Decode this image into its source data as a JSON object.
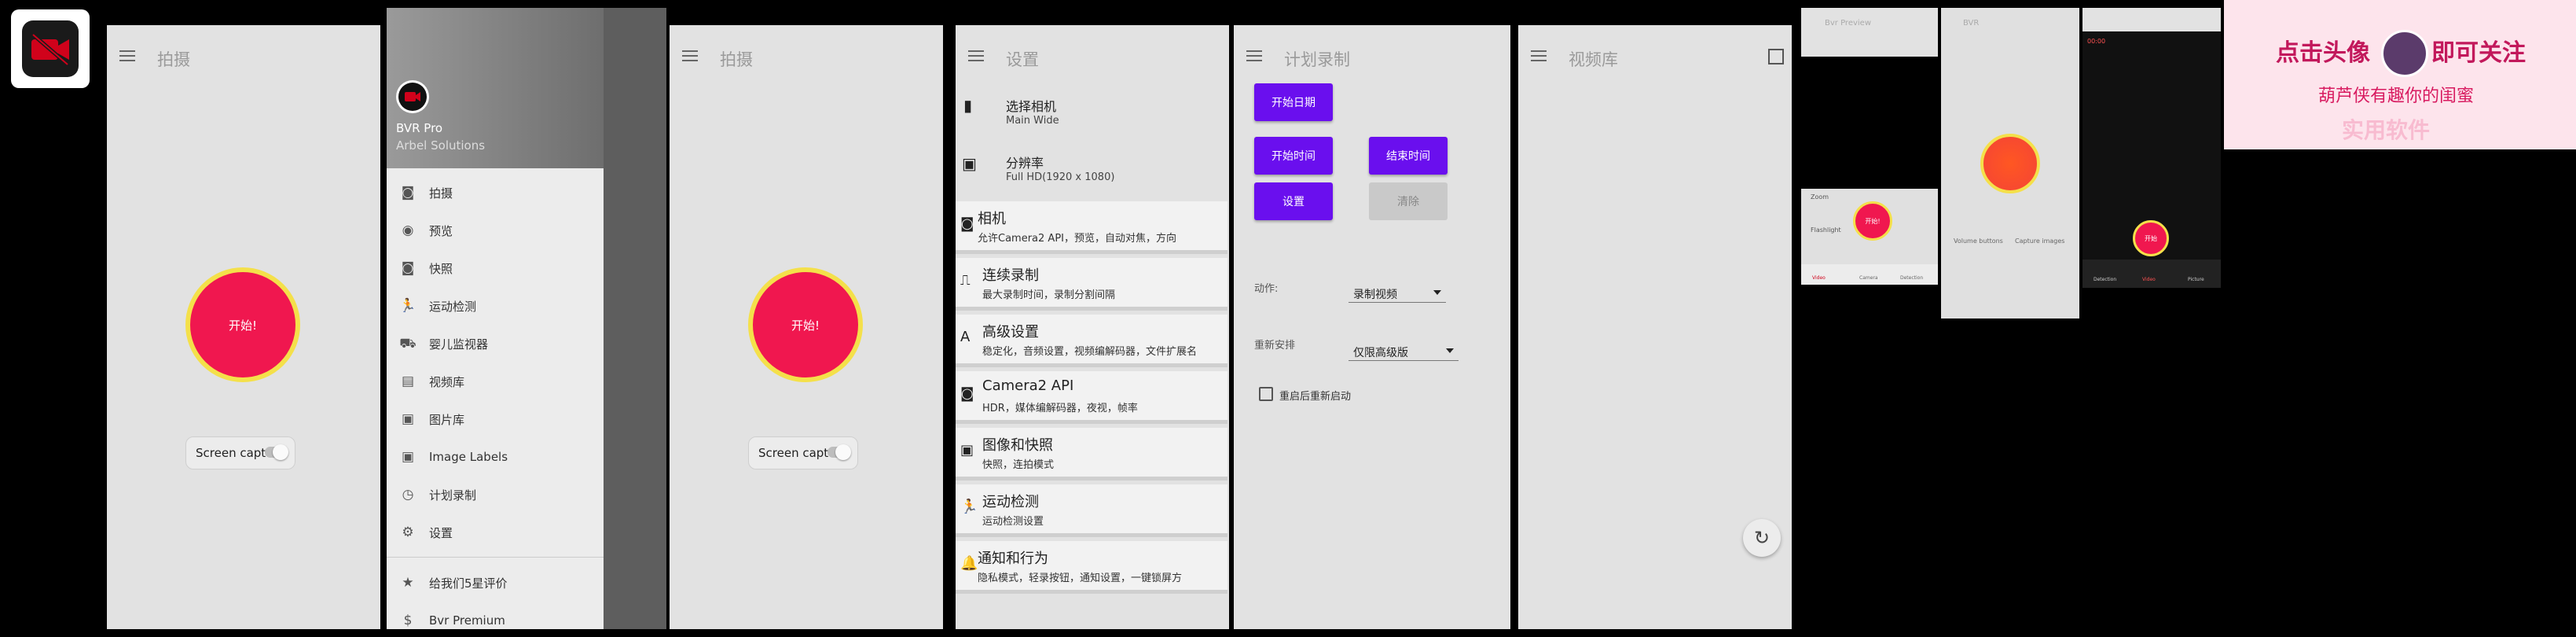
{
  "app_icon": {
    "icon": "camera-off-icon",
    "accent": "#d0021b"
  },
  "home": {
    "title": "拍摄",
    "record_label": "开始!",
    "capture_label": "Screen capture"
  },
  "drawer": {
    "app_name": "BVR Pro",
    "company": "Arbel Solutions",
    "items": [
      {
        "icon": "camera-icon",
        "label": "拍摄"
      },
      {
        "icon": "eye-icon",
        "label": "预览"
      },
      {
        "icon": "camera-icon",
        "label": "快照"
      },
      {
        "icon": "running-icon",
        "label": "运动检测"
      },
      {
        "icon": "stroller-icon",
        "label": "婴儿监视器"
      },
      {
        "icon": "video-library-icon",
        "label": "视频库"
      },
      {
        "icon": "image-icon",
        "label": "图片库"
      },
      {
        "icon": "image-icon",
        "label": "Image Labels"
      },
      {
        "icon": "timer-icon",
        "label": "计划录制"
      },
      {
        "icon": "gear-icon",
        "label": "设置"
      }
    ],
    "footer": [
      {
        "icon": "star-icon",
        "label": "给我们5星评价"
      },
      {
        "icon": "dollar-icon",
        "label": "Bvr Premium"
      }
    ]
  },
  "home2": {
    "title": "拍摄",
    "record_label": "开始!",
    "capture_label": "Screen capture"
  },
  "settings": {
    "title": "设置",
    "rows": [
      {
        "icon": "phone-icon",
        "title": "选择相机",
        "sub": "Main Wide"
      },
      {
        "icon": "resolution-icon",
        "title": "分辨率",
        "sub": "Full HD(1920 x 1080)"
      },
      {
        "icon": "camera-icon",
        "title": "相机",
        "sub": "允许Camera2 API，预览，自动对焦，方向"
      },
      {
        "icon": "pulse-icon",
        "title": "连续录制",
        "sub": "最大录制时间，录制分割间隔"
      },
      {
        "icon": "text-icon",
        "title": "高级设置",
        "sub": "稳定化，音频设置，视频编解码器，文件扩展名"
      },
      {
        "icon": "camera-icon",
        "title": "Camera2 API",
        "sub": "HDR，媒体编解码器，夜视，帧率"
      },
      {
        "icon": "image-icon",
        "title": "图像和快照",
        "sub": "快照，连拍模式"
      },
      {
        "icon": "running-icon",
        "title": "运动检测",
        "sub": "运动检测设置"
      },
      {
        "icon": "bell-icon",
        "title": "通知和行为",
        "sub": "隐私模式，轻录按钮，通知设置，一键锁屏方"
      }
    ]
  },
  "schedule": {
    "title": "计划录制",
    "start_date": "开始日期",
    "start_time": "开始时间",
    "end_time": "结束时间",
    "set": "设置",
    "clear": "清除",
    "action_label": "动作:",
    "action_value": "录制视频",
    "repeat_label": "重新安排",
    "repeat_value": "仅限高级版",
    "restart_label": "重启后重新启动"
  },
  "library": {
    "title": "视频库",
    "refresh_icon": "refresh-icon"
  },
  "thumb1": {
    "title": "Bvr Preview",
    "zoom_label": "Zoom",
    "flash_label": "Flashlight",
    "record_label": "开始!",
    "tabs": [
      "Video",
      "Camera",
      "Detection"
    ]
  },
  "thumb2": {
    "title": "BVR",
    "volume_label": "Volume buttons",
    "capture_label": "Capture images"
  },
  "thumb3": {
    "time": "00:00",
    "record_label": "开始",
    "tabs": [
      "Detection",
      "Video",
      "Picture"
    ]
  },
  "banner": {
    "line1a": "点击头像",
    "line1b": "即可关注",
    "line2": "葫芦侠有趣你的闺蜜",
    "line3": "实用软件",
    "colors": {
      "bg": "#fde4ec",
      "text": "#c2185b"
    }
  }
}
